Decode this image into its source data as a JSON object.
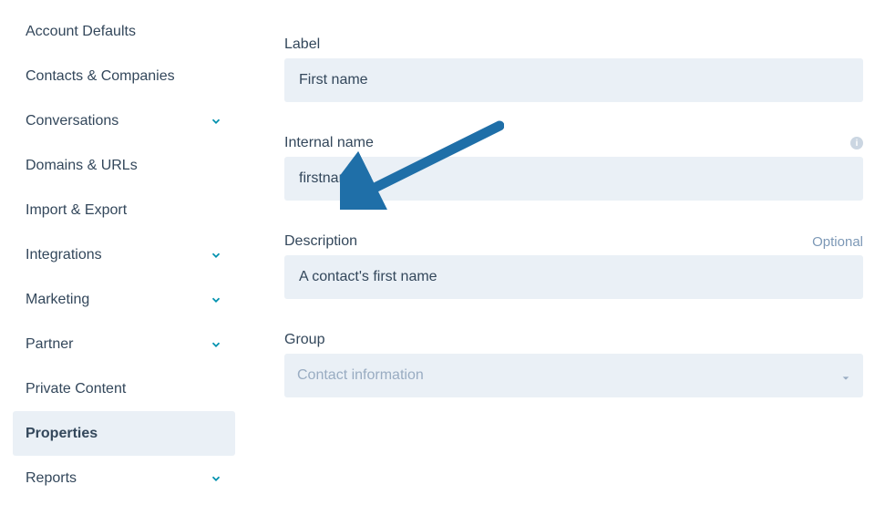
{
  "sidebar": {
    "items": [
      {
        "label": "Account Defaults",
        "expandable": false,
        "active": false
      },
      {
        "label": "Contacts & Companies",
        "expandable": false,
        "active": false
      },
      {
        "label": "Conversations",
        "expandable": true,
        "active": false
      },
      {
        "label": "Domains & URLs",
        "expandable": false,
        "active": false
      },
      {
        "label": "Import & Export",
        "expandable": false,
        "active": false
      },
      {
        "label": "Integrations",
        "expandable": true,
        "active": false
      },
      {
        "label": "Marketing",
        "expandable": true,
        "active": false
      },
      {
        "label": "Partner",
        "expandable": true,
        "active": false
      },
      {
        "label": "Private Content",
        "expandable": false,
        "active": false
      },
      {
        "label": "Properties",
        "expandable": false,
        "active": true
      },
      {
        "label": "Reports",
        "expandable": true,
        "active": false
      }
    ]
  },
  "form": {
    "label_field": {
      "label": "Label",
      "value": "First name"
    },
    "internal_name_field": {
      "label": "Internal name",
      "value": "firstname"
    },
    "description_field": {
      "label": "Description",
      "optional_text": "Optional",
      "value": "A contact's first name"
    },
    "group_field": {
      "label": "Group",
      "value": "Contact information"
    }
  },
  "colors": {
    "accent": "#0091ae",
    "arrow": "#1f6fa8",
    "panel": "#eaf0f6",
    "muted": "#99acc2",
    "text": "#33475b"
  }
}
